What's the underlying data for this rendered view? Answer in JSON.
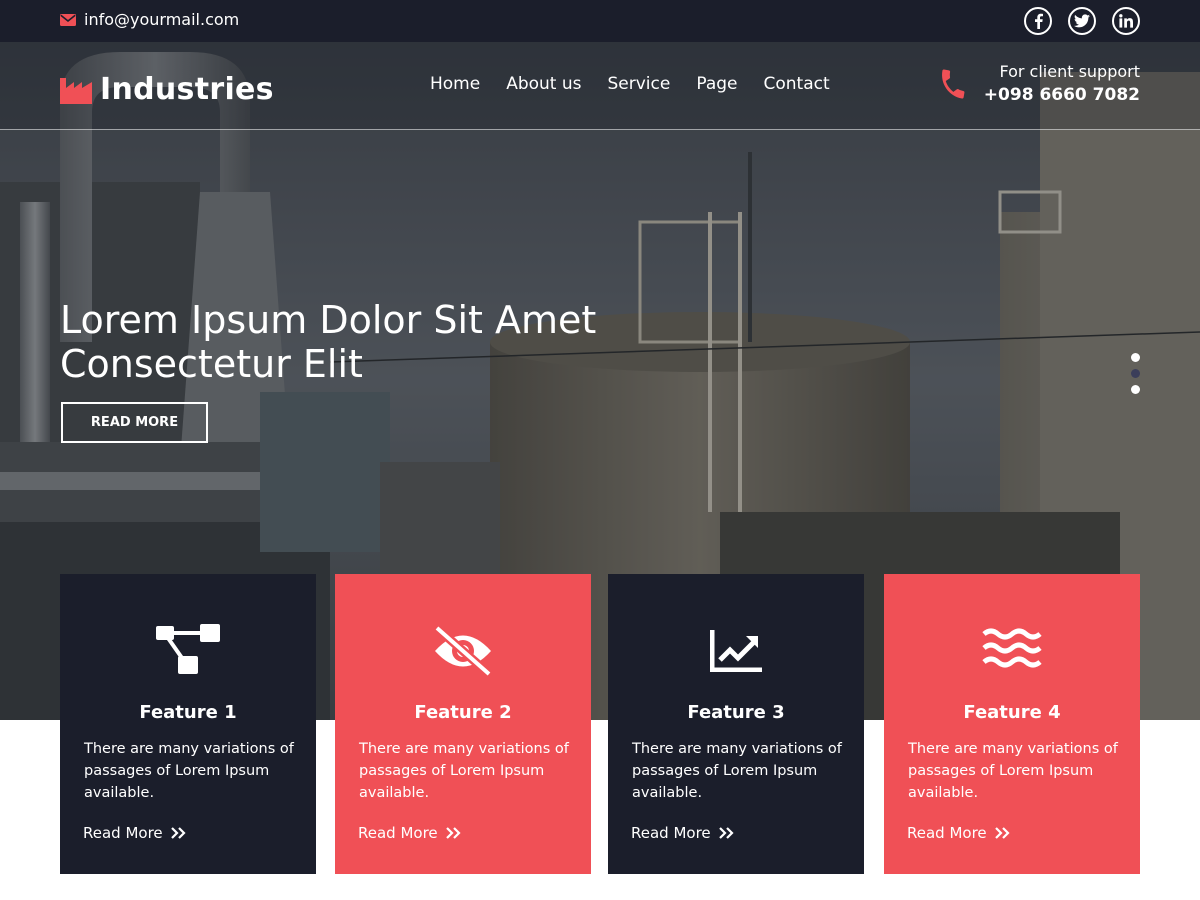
{
  "topbar": {
    "email": "info@yourmail.com",
    "socials": [
      {
        "name": "facebook-icon",
        "glyph": "f"
      },
      {
        "name": "twitter-icon",
        "glyph": "t"
      },
      {
        "name": "linkedin-icon",
        "glyph": "in"
      }
    ]
  },
  "header": {
    "logo_text": "Industries",
    "nav": [
      "Home",
      "About us",
      "Service",
      "Page",
      "Contact"
    ],
    "support_label": "For client support",
    "support_phone": "+098 6660 7082"
  },
  "hero": {
    "title_line1": "Lorem Ipsum Dolor Sit Amet",
    "title_line2": "Consectetur Elit",
    "button_label": "READ MORE"
  },
  "features": [
    {
      "title": "Feature 1",
      "desc": "There are many variations of passages of Lorem Ipsum available.",
      "more": "Read More",
      "icon": "sitemap-icon",
      "theme": "dark"
    },
    {
      "title": "Feature 2",
      "desc": "There are many variations of passages of Lorem Ipsum available.",
      "more": "Read More",
      "icon": "eye-slash-icon",
      "theme": "red"
    },
    {
      "title": "Feature 3",
      "desc": "There are many variations of passages of Lorem Ipsum available.",
      "more": "Read More",
      "icon": "chart-line-icon",
      "theme": "dark"
    },
    {
      "title": "Feature 4",
      "desc": "There are many variations of passages of Lorem Ipsum available.",
      "more": "Read More",
      "icon": "water-icon",
      "theme": "red"
    }
  ],
  "colors": {
    "accent": "#f05056",
    "dark": "#1b1e2b",
    "white": "#ffffff"
  }
}
